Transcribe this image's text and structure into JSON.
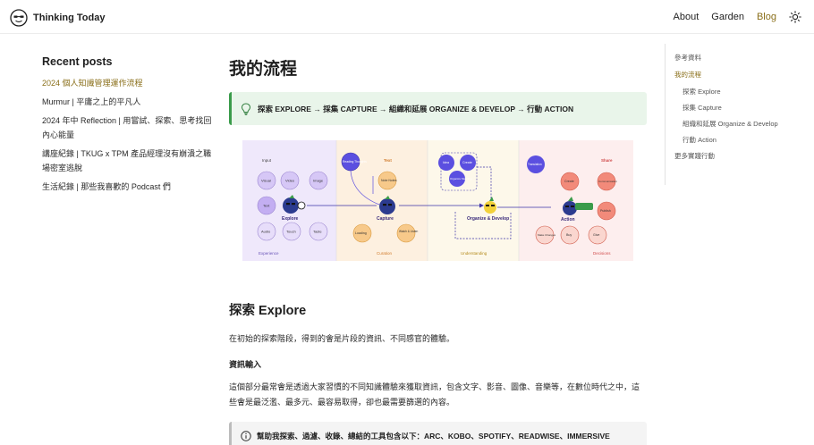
{
  "header": {
    "brand": "Thinking Today",
    "nav": [
      {
        "label": "About"
      },
      {
        "label": "Garden"
      },
      {
        "label": "Blog"
      }
    ]
  },
  "recent": {
    "title": "Recent posts",
    "items": [
      {
        "label": "2024 個人知識管理運作流程"
      },
      {
        "label": "Murmur | 平庸之上的平凡人"
      },
      {
        "label": "2024 年中 Reflection | 用嘗試、探索、思考找回內心能量"
      },
      {
        "label": "講座紀錄 | TKUG x TPM 產品經理沒有崩潰之職場密室逃脫"
      },
      {
        "label": "生活紀錄 | 那些我喜歡的 Podcast 們"
      }
    ]
  },
  "toc": {
    "items": [
      {
        "label": "參考資料"
      },
      {
        "label": "我的流程"
      },
      {
        "label": "探索 Explore"
      },
      {
        "label": "採集 Capture"
      },
      {
        "label": "組織和延展 Organize & Develop"
      },
      {
        "label": "行動 Action"
      },
      {
        "label": "更多實踐行動"
      }
    ]
  },
  "main": {
    "title": "我的流程",
    "tip": "探索 EXPLORE → 採集 CAPTURE → 組織和延展 ORGANIZE & DEVELOP → 行動 ACTION",
    "section_title": "探索 Explore",
    "intro": "在初始的探索階段，得到的會是片段的資訊、不同感官的體驗。",
    "subheading": "資訊輸入",
    "paragraph": "這個部分最常會是透過大家習慣的不同知識體驗來獲取資訊，包含文字、影音、圖像、音樂等，在數位時代之中，這些會是最泛濫、最多元、最容易取得，卻也最需要篩選的內容。",
    "callout": "幫助我探索、過濾、收錄、總結的工具包含以下：ARC、KOBO、SPOTIFY、READWISE、IMMERSIVE TRANSLATE、CHATGPT。"
  },
  "diagram": {
    "stages": [
      "Explore",
      "Capture",
      "Organize & Develop",
      "Action"
    ],
    "explore_nodes": [
      "Input",
      "Visual",
      "Video",
      "Image",
      "Text",
      "Audio",
      "Touch",
      "Taste"
    ],
    "explore_footer": "Experience",
    "capture_nodes": [
      "Reading Thoughts",
      "Text",
      "Note Notes",
      "Loading",
      "Watch & Listen"
    ],
    "capture_footer": "Curation",
    "organize_nodes": [
      "Idea",
      "Create",
      "Organize Meaning"
    ],
    "organize_footer": "Understanding",
    "action_nodes": [
      "Share",
      "Translation",
      "Create",
      "Communication",
      "Publish",
      "Make Changes",
      "Buy",
      "Give"
    ],
    "action_footer": "Decisions",
    "colors": {
      "explore": "#efe8fb",
      "capture": "#fdf0e0",
      "organize": "#fdf8ea",
      "action": "#fdeeee"
    }
  }
}
